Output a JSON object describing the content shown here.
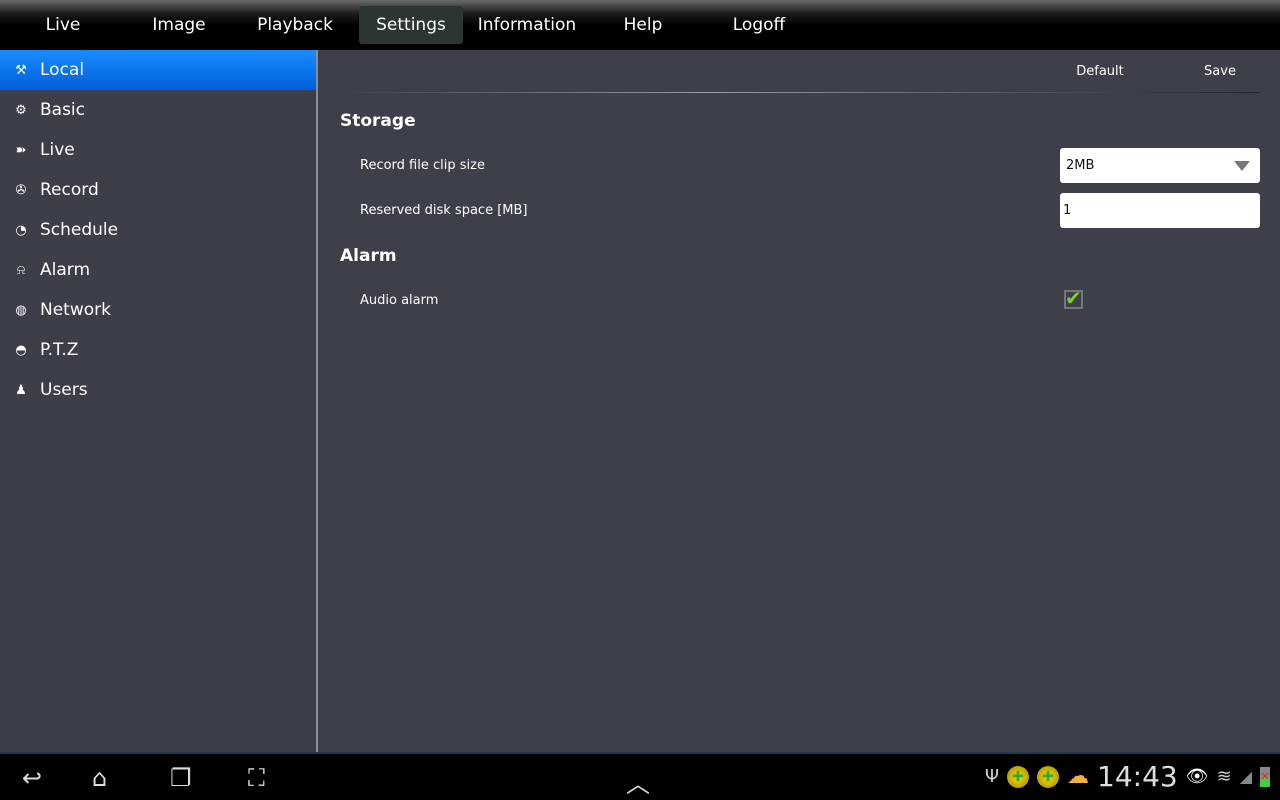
{
  "topnav": {
    "tabs": [
      {
        "label": "Live"
      },
      {
        "label": "Image"
      },
      {
        "label": "Playback"
      },
      {
        "label": "Settings",
        "active": true
      },
      {
        "label": "Information"
      },
      {
        "label": "Help"
      },
      {
        "label": "Logoff"
      }
    ]
  },
  "sidebar": {
    "items": [
      {
        "label": "Local",
        "icon": "tools-icon",
        "active": true
      },
      {
        "label": "Basic",
        "icon": "gear-icon"
      },
      {
        "label": "Live",
        "icon": "camera-icon"
      },
      {
        "label": "Record",
        "icon": "film-reel-icon"
      },
      {
        "label": "Schedule",
        "icon": "clock-icon"
      },
      {
        "label": "Alarm",
        "icon": "alarm-icon"
      },
      {
        "label": "Network",
        "icon": "globe-icon"
      },
      {
        "label": "P.T.Z",
        "icon": "dome-camera-icon"
      },
      {
        "label": "Users",
        "icon": "user-icon"
      }
    ]
  },
  "main": {
    "default_label": "Default",
    "save_label": "Save",
    "storage": {
      "title": "Storage",
      "clip_size_label": "Record file clip size",
      "clip_size_value": "2MB",
      "reserved_label": "Reserved disk space [MB]",
      "reserved_value": "1"
    },
    "alarm": {
      "title": "Alarm",
      "audio_label": "Audio alarm",
      "audio_checked": true
    }
  },
  "statusbar": {
    "time": "14:43"
  },
  "colors": {
    "accent": "#0a7af0",
    "check": "#7ed321"
  }
}
